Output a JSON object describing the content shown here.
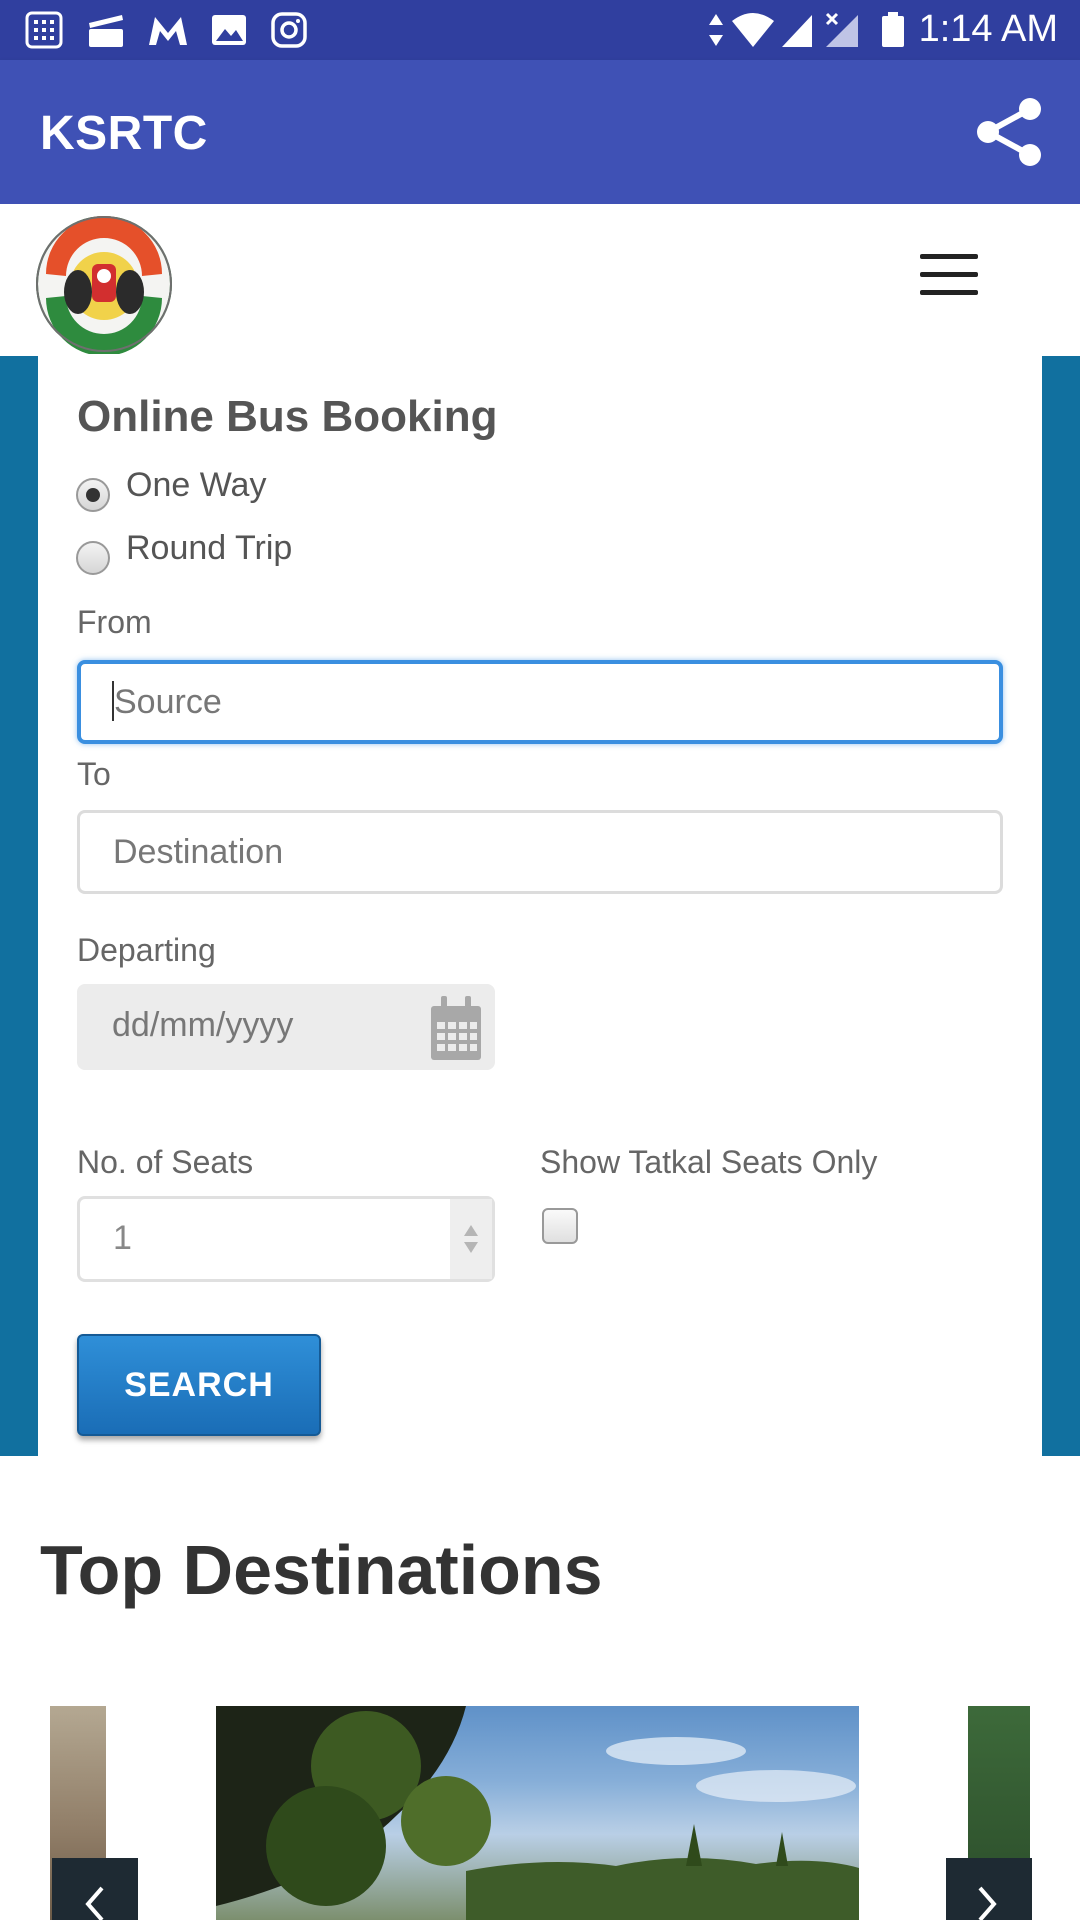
{
  "status_bar": {
    "time": "1:14 AM",
    "left_icons": [
      "calculator-icon",
      "clapperboard-icon",
      "gmail-icon",
      "gallery-icon",
      "instagram-icon"
    ],
    "right_icons": [
      "data-arrows-icon",
      "wifi-icon",
      "signal-icon",
      "signal-no-data-icon",
      "battery-icon"
    ]
  },
  "app_bar": {
    "title": "KSRTC",
    "share_icon": "share-icon",
    "color": "#3f51b5"
  },
  "site_header": {
    "logo": "ksrtc-emblem",
    "menu_icon": "hamburger-menu-icon"
  },
  "booking": {
    "title": "Online Bus Booking",
    "trip_types": [
      {
        "label": "One Way",
        "checked": true
      },
      {
        "label": "Round Trip",
        "checked": false
      }
    ],
    "from_label": "From",
    "from_placeholder": "Source",
    "to_label": "To",
    "to_placeholder": "Destination",
    "departing_label": "Departing",
    "departing_placeholder": "dd/mm/yyyy",
    "seats_label": "No. of Seats",
    "seats_value": "1",
    "tatkal_label": "Show Tatkal Seats Only",
    "tatkal_checked": false,
    "search_label": "SEARCH",
    "accent_color": "#11709f"
  },
  "destinations": {
    "heading": "Top Destinations",
    "prev_icon": "chevron-left-icon",
    "next_icon": "chevron-right-icon"
  }
}
